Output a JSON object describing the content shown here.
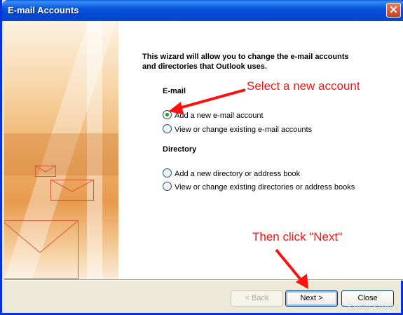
{
  "window": {
    "title": "E-mail Accounts"
  },
  "intro": "This wizard will allow you to change the e-mail accounts and directories that Outlook uses.",
  "email_section": {
    "heading": "E-mail",
    "options": [
      {
        "label": "Add a new e-mail account",
        "selected": true
      },
      {
        "label": "View or change existing e-mail accounts",
        "selected": false
      }
    ]
  },
  "directory_section": {
    "heading": "Directory",
    "options": [
      {
        "label": "Add a new directory or address book",
        "selected": false
      },
      {
        "label": "View or change existing directories or address books",
        "selected": false
      }
    ]
  },
  "annotations": {
    "select": "Select a new account",
    "next": "Then click \"Next\""
  },
  "buttons": {
    "back": "< Back",
    "next": "Next >",
    "close": "Close"
  },
  "watermark": "Spiffy Stores",
  "colors": {
    "annotation": "#ff1010",
    "titlebar": "#0a5ce8"
  }
}
